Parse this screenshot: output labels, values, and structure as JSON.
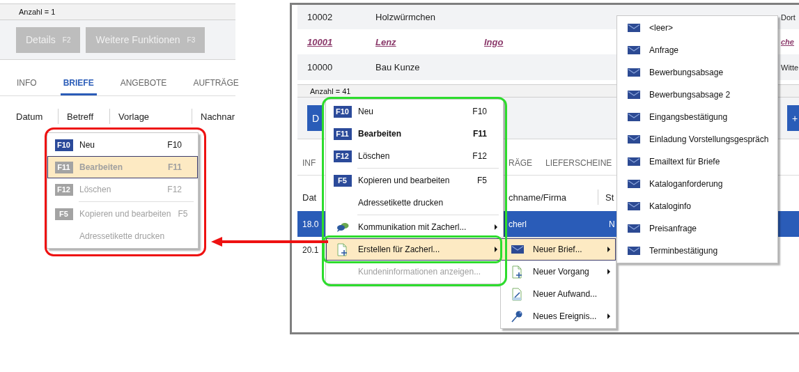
{
  "left_panel": {
    "count": "Anzahl = 1",
    "buttons": [
      {
        "label": "Details",
        "key": "F2"
      },
      {
        "label": "Weitere Funktionen",
        "key": "F3"
      }
    ],
    "tabs": [
      {
        "label": "INFO",
        "selected": false
      },
      {
        "label": "BRIEFE",
        "selected": true
      },
      {
        "label": "ANGEBOTE",
        "selected": false
      },
      {
        "label": "AUFTRÄGE",
        "selected": false
      }
    ],
    "columns": [
      "Datum",
      "Betreff",
      "Vorlage",
      "Nachnar"
    ],
    "context_menu": [
      {
        "kind": "command",
        "badge": "F10",
        "label": "Neu",
        "shortcut": "F10",
        "bold": false,
        "disabled": false,
        "selected": false,
        "submenu": false
      },
      {
        "kind": "command",
        "badge": "F11",
        "label": "Bearbeiten",
        "shortcut": "F11",
        "bold": true,
        "disabled": true,
        "selected": true,
        "submenu": false
      },
      {
        "kind": "command",
        "badge": "F12",
        "label": "Löschen",
        "shortcut": "F12",
        "bold": false,
        "disabled": true,
        "selected": false,
        "submenu": false
      },
      {
        "kind": "separator"
      },
      {
        "kind": "command",
        "badge": "F5",
        "label": "Kopieren und bearbeiten",
        "shortcut": "F5",
        "bold": false,
        "disabled": true,
        "selected": false,
        "submenu": false
      },
      {
        "kind": "command",
        "label": "Adressetikette drucken",
        "bold": false,
        "disabled": true,
        "selected": false,
        "submenu": false
      }
    ]
  },
  "right_panel": {
    "top_table": {
      "rows": [
        {
          "kind": "plain",
          "cells": [
            "10002",
            "Holzwürmchen"
          ],
          "edge": "Dort"
        },
        {
          "kind": "link",
          "cells": [
            "10001",
            "Lenz",
            "Ingo"
          ],
          "edge": "che"
        },
        {
          "kind": "plain",
          "cells": [
            "10000",
            "Bau Kunze"
          ],
          "edge": "Witte"
        }
      ]
    },
    "count": "Anzahl = 41",
    "buttons": [
      {
        "label": "D"
      },
      {
        "label": "+"
      }
    ],
    "tabs": [
      {
        "label": "INF",
        "selected": false
      },
      {
        "label": "RÄGE",
        "selected": false
      },
      {
        "label": "LIEFERSCHEINE",
        "selected": false
      }
    ],
    "bottom_table": {
      "columns": [
        "Dat",
        "chname/Firma",
        "St"
      ],
      "rows": [
        {
          "cells": [
            "18.0",
            "cherl",
            "N"
          ],
          "selected": true
        },
        {
          "cells": [
            "20.1"
          ],
          "selected": false
        }
      ]
    },
    "context_menu": [
      {
        "kind": "command",
        "badge": "F10",
        "label": "Neu",
        "shortcut": "F10",
        "bold": false,
        "disabled": false,
        "selected": false,
        "submenu": false
      },
      {
        "kind": "command",
        "badge": "F11",
        "label": "Bearbeiten",
        "shortcut": "F11",
        "bold": true,
        "disabled": false,
        "selected": false,
        "submenu": false
      },
      {
        "kind": "command",
        "badge": "F12",
        "label": "Löschen",
        "shortcut": "F12",
        "bold": false,
        "disabled": false,
        "selected": false,
        "submenu": false
      },
      {
        "kind": "separator"
      },
      {
        "kind": "command",
        "badge": "F5",
        "label": "Kopieren und bearbeiten",
        "shortcut": "F5",
        "bold": false,
        "disabled": false,
        "selected": false,
        "submenu": false
      },
      {
        "kind": "command",
        "label": "Adressetikette drucken",
        "bold": false,
        "disabled": false,
        "selected": false,
        "submenu": false
      },
      {
        "kind": "separator"
      },
      {
        "kind": "communication",
        "label": "Kommunikation mit Zacherl...",
        "bold": false,
        "disabled": false,
        "selected": false,
        "submenu": true
      },
      {
        "kind": "create",
        "label": "Erstellen für Zacherl...",
        "bold": false,
        "disabled": false,
        "selected": true,
        "submenu": true
      },
      {
        "kind": "command",
        "label": "Kundeninformationen anzeigen...",
        "bold": false,
        "disabled": true,
        "selected": false,
        "submenu": false
      }
    ],
    "create_submenu": [
      {
        "kind": "letter",
        "label": "Neuer Brief...",
        "bold": false,
        "disabled": false,
        "selected": true,
        "submenu": true
      },
      {
        "kind": "create",
        "label": "Neuer Vorgang",
        "bold": false,
        "disabled": false,
        "selected": false,
        "submenu": true
      },
      {
        "kind": "expense",
        "label": "Neuer Aufwand...",
        "bold": false,
        "disabled": false,
        "selected": false,
        "submenu": false
      },
      {
        "kind": "event",
        "label": "Neues Ereignis...",
        "bold": false,
        "disabled": false,
        "selected": false,
        "submenu": true
      }
    ],
    "letter_submenu": [
      {
        "kind": "letter",
        "label": "<leer>",
        "bold": false,
        "disabled": false,
        "selected": false,
        "submenu": false
      },
      {
        "kind": "letter",
        "label": "Anfrage",
        "bold": false,
        "disabled": false,
        "selected": false,
        "submenu": false
      },
      {
        "kind": "letter",
        "label": "Bewerbungsabsage",
        "bold": false,
        "disabled": false,
        "selected": false,
        "submenu": false
      },
      {
        "kind": "letter",
        "label": "Bewerbungsabsage 2",
        "bold": false,
        "disabled": false,
        "selected": false,
        "submenu": false
      },
      {
        "kind": "letter",
        "label": "Eingangsbestätigung",
        "bold": false,
        "disabled": false,
        "selected": false,
        "submenu": false
      },
      {
        "kind": "letter",
        "label": "Einladung Vorstellungsgespräch",
        "bold": false,
        "disabled": false,
        "selected": false,
        "submenu": false
      },
      {
        "kind": "letter",
        "label": "Emailtext für Briefe",
        "bold": false,
        "disabled": false,
        "selected": false,
        "submenu": false
      },
      {
        "kind": "letter",
        "label": "Kataloganforderung",
        "bold": false,
        "disabled": false,
        "selected": false,
        "submenu": false
      },
      {
        "kind": "letter",
        "label": "Kataloginfo",
        "bold": false,
        "disabled": false,
        "selected": false,
        "submenu": false
      },
      {
        "kind": "letter",
        "label": "Preisanfrage",
        "bold": false,
        "disabled": false,
        "selected": false,
        "submenu": false
      },
      {
        "kind": "letter",
        "label": "Terminbestätigung",
        "bold": false,
        "disabled": false,
        "selected": false,
        "submenu": false
      }
    ]
  }
}
